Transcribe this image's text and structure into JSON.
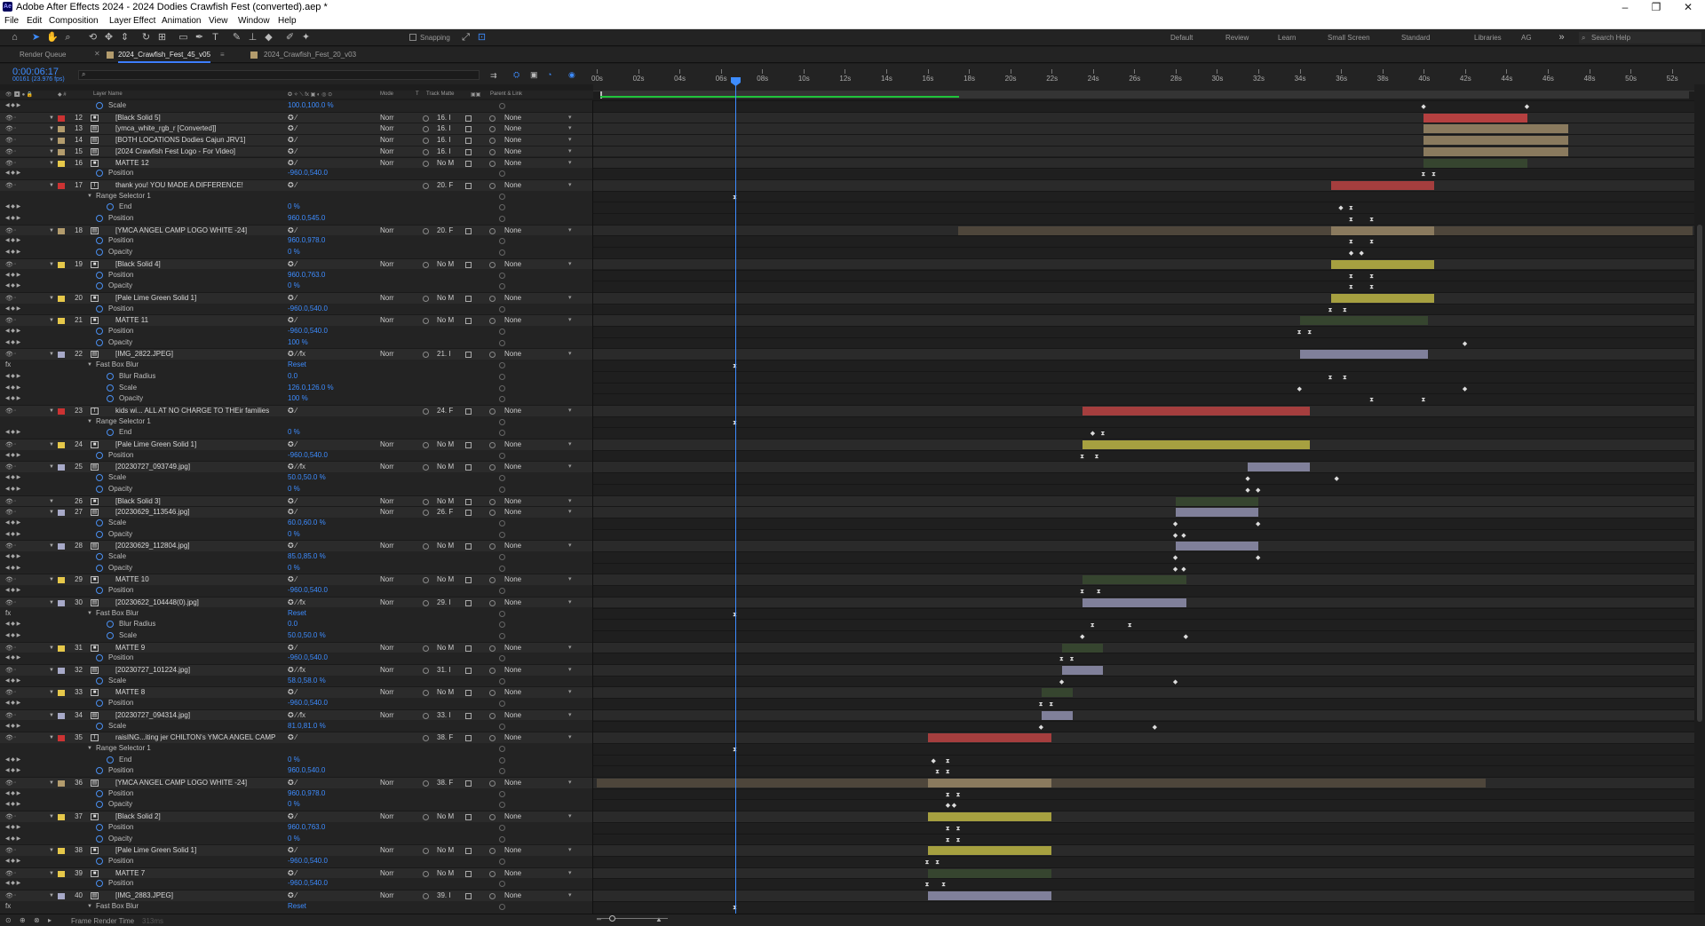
{
  "window": {
    "title": "Adobe After Effects 2024 - 2024 Dodies Crawfish Fest (converted).aep *",
    "app_logo": "Ae"
  },
  "menu": [
    "File",
    "Edit",
    "Composition",
    "Layer",
    "Effect",
    "Animation",
    "View",
    "Window",
    "Help"
  ],
  "toolbar": {
    "snapping_label": "Snapping"
  },
  "workspaces": [
    "Default",
    "Review",
    "Learn",
    "Small Screen",
    "Standard",
    "Libraries",
    "AG"
  ],
  "search_help": "Search Help",
  "tabs": [
    {
      "label": "Render Queue"
    },
    {
      "label": "2024_Crawfish_Fest_45_v05"
    },
    {
      "label": "2024_Crawfish_Fest_20_v03"
    }
  ],
  "timecode": "0:00:06:17",
  "frames": "00161 (23.976 fps)",
  "columns": {
    "layer_name": "Layer Name",
    "mode": "Mode",
    "t": "T",
    "track_matte": "Track Matte",
    "parent": "Parent & Link"
  },
  "ruler": {
    "ticks": [
      "00s",
      "02s",
      "04s",
      "06s",
      "08s",
      "10s",
      "12s",
      "14s",
      "16s",
      "18s",
      "20s",
      "22s",
      "24s",
      "26s",
      "28s",
      "30s",
      "32s",
      "34s",
      "36s",
      "38s",
      "40s",
      "42s",
      "44s",
      "46s",
      "48s",
      "50s",
      "52s"
    ],
    "duration_s": 53
  },
  "playhead_s": 6.7,
  "rows": [
    {
      "t": "p",
      "name": "Scale",
      "val": "100.0,100.0 %",
      "kf": [
        [
          40.0,
          "d"
        ],
        [
          45.0,
          "d"
        ]
      ]
    },
    {
      "t": "l",
      "num": "12",
      "name": "[Black Solid 5]",
      "color": "#cc3333",
      "type": "s",
      "mode": "Norr",
      "tm": "16. I",
      "parent": "None",
      "bar": [
        40.0,
        45.0,
        "#b54040"
      ]
    },
    {
      "t": "l",
      "num": "13",
      "name": "[ymca_white_rgb_r [Converted]]",
      "color": "#b39c6d",
      "type": "i",
      "mode": "Norr",
      "tm": "16. I",
      "parent": "None",
      "bar": [
        40.0,
        47.0,
        "#8a7a5e"
      ]
    },
    {
      "t": "l",
      "num": "14",
      "name": "[BOTH LOCATIONS Dodies Cajun JRV1]",
      "color": "#b39c6d",
      "type": "i",
      "mode": "Norr",
      "tm": "16. I",
      "parent": "None",
      "bar": [
        40.0,
        47.0,
        "#8a7a5e"
      ]
    },
    {
      "t": "l",
      "num": "15",
      "name": "[2024 Crawfish Fest Logo - For Video]",
      "color": "#b39c6d",
      "type": "i",
      "mode": "Norr",
      "tm": "16. I",
      "parent": "None",
      "bar": [
        40.0,
        47.0,
        "#8a7a5e"
      ]
    },
    {
      "t": "l",
      "num": "16",
      "name": "MATTE 12",
      "color": "#e6c84a",
      "type": "s",
      "mode": "Norr",
      "tm": "No M",
      "parent": "None",
      "bar": [
        40.0,
        45.0,
        "#36452f"
      ]
    },
    {
      "t": "p",
      "name": "Position",
      "val": "-960.0,540.0",
      "kf": [
        [
          40.0,
          "i"
        ],
        [
          40.5,
          "i"
        ]
      ]
    },
    {
      "t": "l",
      "num": "17",
      "name": "thank you! YOU MADE A DIFFERENCE!",
      "color": "#cc3333",
      "type": "t",
      "mode": "",
      "tm": "20. F",
      "parent": "None",
      "bar": [
        35.5,
        40.5,
        "#a53e3e"
      ]
    },
    {
      "t": "g",
      "name": "Range Selector 1",
      "kf": [
        [
          6.7,
          "i"
        ]
      ]
    },
    {
      "t": "p",
      "name": "End",
      "val": "0 %",
      "kf": [
        [
          36.0,
          "d"
        ],
        [
          36.5,
          "i"
        ]
      ],
      "indent": 1
    },
    {
      "t": "p",
      "name": "Position",
      "val": "960.0,545.0",
      "kf": [
        [
          36.5,
          "i"
        ],
        [
          37.5,
          "i"
        ]
      ]
    },
    {
      "t": "l",
      "num": "18",
      "name": "[YMCA ANGEL CAMP LOGO WHITE -24]",
      "color": "#b39c6d",
      "type": "i",
      "mode": "Norr",
      "tm": "20. F",
      "parent": "None",
      "bar": [
        35.5,
        40.5,
        "#8a7a5e"
      ],
      "bar2": [
        17.5,
        53,
        "#4e463b"
      ]
    },
    {
      "t": "p",
      "name": "Position",
      "val": "960.0,978.0",
      "kf": [
        [
          36.5,
          "i"
        ],
        [
          37.5,
          "i"
        ]
      ]
    },
    {
      "t": "p",
      "name": "Opacity",
      "val": "0 %",
      "kf": [
        [
          36.5,
          "d"
        ],
        [
          37.0,
          "d"
        ]
      ]
    },
    {
      "t": "l",
      "num": "19",
      "name": "[Black Solid 4]",
      "color": "#e6c84a",
      "type": "s",
      "mode": "Norr",
      "tm": "No M",
      "parent": "None",
      "bar": [
        35.5,
        40.5,
        "#a6a040"
      ]
    },
    {
      "t": "p",
      "name": "Position",
      "val": "960.0,763.0",
      "kf": [
        [
          36.5,
          "i"
        ],
        [
          37.5,
          "i"
        ]
      ]
    },
    {
      "t": "p",
      "name": "Opacity",
      "val": "0 %",
      "kf": [
        [
          36.5,
          "i"
        ],
        [
          37.5,
          "i"
        ]
      ]
    },
    {
      "t": "l",
      "num": "20",
      "name": "[Pale Lime Green Solid 1]",
      "color": "#e6c84a",
      "type": "s",
      "mode": "Norr",
      "tm": "No M",
      "parent": "None",
      "bar": [
        35.5,
        40.5,
        "#a6a040"
      ]
    },
    {
      "t": "p",
      "name": "Position",
      "val": "-960.0,540.0",
      "kf": [
        [
          35.5,
          "i"
        ],
        [
          36.2,
          "i"
        ]
      ]
    },
    {
      "t": "l",
      "num": "21",
      "name": "MATTE 11",
      "color": "#e6c84a",
      "type": "s",
      "mode": "Norr",
      "tm": "No M",
      "parent": "None",
      "bar": [
        34.0,
        40.2,
        "#36452f"
      ]
    },
    {
      "t": "p",
      "name": "Position",
      "val": "-960.0,540.0",
      "kf": [
        [
          34.0,
          "i"
        ],
        [
          34.5,
          "i"
        ]
      ]
    },
    {
      "t": "p",
      "name": "Opacity",
      "val": "100 %",
      "kf": [
        [
          42.0,
          "d"
        ]
      ]
    },
    {
      "t": "l",
      "num": "22",
      "name": "[IMG_2822.JPEG]",
      "color": "#a7a9c8",
      "type": "i",
      "mode": "Norr",
      "tm": "21. I",
      "parent": "None",
      "bar": [
        34.0,
        40.2,
        "#80809a"
      ],
      "fx": true
    },
    {
      "t": "fx",
      "name": "Fast Box Blur",
      "val": "Reset",
      "kf": [
        [
          6.7,
          "i"
        ]
      ]
    },
    {
      "t": "p",
      "name": "Blur Radius",
      "val": "0.0",
      "kf": [
        [
          35.5,
          "i"
        ],
        [
          36.2,
          "i"
        ]
      ],
      "indent": 1
    },
    {
      "t": "p",
      "name": "Scale",
      "val": "126.0,126.0 %",
      "kf": [
        [
          34.0,
          "d"
        ],
        [
          42.0,
          "d"
        ]
      ],
      "indent": 1
    },
    {
      "t": "p",
      "name": "Opacity",
      "val": "100 %",
      "kf": [
        [
          37.5,
          "i"
        ],
        [
          40.0,
          "i"
        ]
      ],
      "indent": 1
    },
    {
      "t": "l",
      "num": "23",
      "name": "kids wi... ALL AT NO CHARGE TO THEir families",
      "color": "#cc3333",
      "type": "t",
      "mode": "",
      "tm": "24. F",
      "parent": "None",
      "bar": [
        23.5,
        34.5,
        "#a53e3e"
      ]
    },
    {
      "t": "g",
      "name": "Range Selector 1",
      "kf": [
        [
          6.7,
          "i"
        ]
      ]
    },
    {
      "t": "p",
      "name": "End",
      "val": "0 %",
      "kf": [
        [
          24.0,
          "d"
        ],
        [
          24.5,
          "i"
        ]
      ],
      "indent": 1
    },
    {
      "t": "l",
      "num": "24",
      "name": "[Pale Lime Green Solid 1]",
      "color": "#e6c84a",
      "type": "s",
      "mode": "Norr",
      "tm": "No M",
      "parent": "None",
      "bar": [
        23.5,
        34.5,
        "#a6a040"
      ]
    },
    {
      "t": "p",
      "name": "Position",
      "val": "-960.0,540.0",
      "kf": [
        [
          23.5,
          "i"
        ],
        [
          24.2,
          "i"
        ]
      ]
    },
    {
      "t": "l",
      "num": "25",
      "name": "[20230727_093749.jpg]",
      "color": "#a7a9c8",
      "type": "i",
      "mode": "Norr",
      "tm": "No M",
      "parent": "None",
      "bar": [
        31.5,
        34.5,
        "#80809a"
      ],
      "fx": true
    },
    {
      "t": "p",
      "name": "Scale",
      "val": "50.0,50.0 %",
      "kf": [
        [
          31.5,
          "d"
        ],
        [
          35.8,
          "d"
        ]
      ]
    },
    {
      "t": "p",
      "name": "Opacity",
      "val": "0 %",
      "kf": [
        [
          31.5,
          "d"
        ],
        [
          32.0,
          "d"
        ]
      ]
    },
    {
      "t": "l",
      "num": "26",
      "name": "[Black Solid 3]",
      "color": "",
      "type": "s",
      "mode": "Norr",
      "tm": "No M",
      "parent": "None",
      "bar": [
        28.0,
        32.0,
        "#36452f"
      ]
    },
    {
      "t": "l",
      "num": "27",
      "name": "[20230629_113546.jpg]",
      "color": "#a7a9c8",
      "type": "i",
      "mode": "Norr",
      "tm": "26. F",
      "parent": "None",
      "bar": [
        28.0,
        32.0,
        "#80809a"
      ]
    },
    {
      "t": "p",
      "name": "Scale",
      "val": "60.0,60.0 %",
      "kf": [
        [
          28.0,
          "d"
        ],
        [
          32.0,
          "d"
        ]
      ]
    },
    {
      "t": "p",
      "name": "Opacity",
      "val": "0 %",
      "kf": [
        [
          28.0,
          "d"
        ],
        [
          28.4,
          "d"
        ]
      ]
    },
    {
      "t": "l",
      "num": "28",
      "name": "[20230629_112804.jpg]",
      "color": "#a7a9c8",
      "type": "i",
      "mode": "Norr",
      "tm": "No M",
      "parent": "None",
      "bar": [
        28.0,
        32.0,
        "#80809a"
      ]
    },
    {
      "t": "p",
      "name": "Scale",
      "val": "85.0,85.0 %",
      "kf": [
        [
          28.0,
          "d"
        ],
        [
          32.0,
          "d"
        ]
      ]
    },
    {
      "t": "p",
      "name": "Opacity",
      "val": "0 %",
      "kf": [
        [
          28.0,
          "d"
        ],
        [
          28.4,
          "d"
        ]
      ]
    },
    {
      "t": "l",
      "num": "29",
      "name": "MATTE 10",
      "color": "#e6c84a",
      "type": "s",
      "mode": "Norr",
      "tm": "No M",
      "parent": "None",
      "bar": [
        23.5,
        28.5,
        "#36452f"
      ]
    },
    {
      "t": "p",
      "name": "Position",
      "val": "-960.0,540.0",
      "kf": [
        [
          23.5,
          "i"
        ],
        [
          24.3,
          "i"
        ]
      ]
    },
    {
      "t": "l",
      "num": "30",
      "name": "[20230622_104448(0).jpg]",
      "color": "#a7a9c8",
      "type": "i",
      "mode": "Norr",
      "tm": "29. I",
      "parent": "None",
      "bar": [
        23.5,
        28.5,
        "#80809a"
      ],
      "fx": true
    },
    {
      "t": "fx",
      "name": "Fast Box Blur",
      "val": "Reset",
      "kf": [
        [
          6.7,
          "i"
        ]
      ]
    },
    {
      "t": "p",
      "name": "Blur Radius",
      "val": "0.0",
      "kf": [
        [
          24.0,
          "i"
        ],
        [
          25.8,
          "i"
        ]
      ],
      "indent": 1
    },
    {
      "t": "p",
      "name": "Scale",
      "val": "50.0,50.0 %",
      "kf": [
        [
          23.5,
          "d"
        ],
        [
          28.5,
          "d"
        ]
      ],
      "indent": 1
    },
    {
      "t": "l",
      "num": "31",
      "name": "MATTE 9",
      "color": "#e6c84a",
      "type": "s",
      "mode": "Norr",
      "tm": "No M",
      "parent": "None",
      "bar": [
        22.5,
        24.5,
        "#36452f"
      ]
    },
    {
      "t": "p",
      "name": "Position",
      "val": "-960.0,540.0",
      "kf": [
        [
          22.5,
          "i"
        ],
        [
          23.0,
          "i"
        ]
      ]
    },
    {
      "t": "l",
      "num": "32",
      "name": "[20230727_101224.jpg]",
      "color": "#a7a9c8",
      "type": "i",
      "mode": "Norr",
      "tm": "31. I",
      "parent": "None",
      "bar": [
        22.5,
        24.5,
        "#80809a"
      ],
      "fx": true
    },
    {
      "t": "p",
      "name": "Scale",
      "val": "58.0,58.0 %",
      "kf": [
        [
          22.5,
          "d"
        ],
        [
          28.0,
          "d"
        ]
      ]
    },
    {
      "t": "l",
      "num": "33",
      "name": "MATTE 8",
      "color": "#e6c84a",
      "type": "s",
      "mode": "Norr",
      "tm": "No M",
      "parent": "None",
      "bar": [
        21.5,
        23.0,
        "#36452f"
      ]
    },
    {
      "t": "p",
      "name": "Position",
      "val": "-960.0,540.0",
      "kf": [
        [
          21.5,
          "i"
        ],
        [
          22.0,
          "i"
        ]
      ]
    },
    {
      "t": "l",
      "num": "34",
      "name": "[20230727_094314.jpg]",
      "color": "#a7a9c8",
      "type": "i",
      "mode": "Norr",
      "tm": "33. I",
      "parent": "None",
      "bar": [
        21.5,
        23.0,
        "#80809a"
      ],
      "fx": true
    },
    {
      "t": "p",
      "name": "Scale",
      "val": "81.0,81.0 %",
      "kf": [
        [
          21.5,
          "d"
        ],
        [
          27.0,
          "d"
        ]
      ]
    },
    {
      "t": "l",
      "num": "35",
      "name": "raisING...iting jer CHILTON's YMCA ANGEL CAMP",
      "color": "#cc3333",
      "type": "t",
      "mode": "",
      "tm": "38. F",
      "parent": "None",
      "bar": [
        16.0,
        22.0,
        "#a53e3e"
      ]
    },
    {
      "t": "g",
      "name": "Range Selector 1",
      "kf": [
        [
          6.7,
          "i"
        ]
      ]
    },
    {
      "t": "p",
      "name": "End",
      "val": "0 %",
      "kf": [
        [
          16.3,
          "d"
        ],
        [
          17.0,
          "i"
        ]
      ],
      "indent": 1
    },
    {
      "t": "p",
      "name": "Position",
      "val": "960.0,540.0",
      "kf": [
        [
          16.5,
          "i"
        ],
        [
          17.0,
          "i"
        ]
      ]
    },
    {
      "t": "l",
      "num": "36",
      "name": "[YMCA ANGEL CAMP LOGO WHITE -24]",
      "color": "#b39c6d",
      "type": "i",
      "mode": "Norr",
      "tm": "38. F",
      "parent": "None",
      "bar": [
        16.0,
        22.0,
        "#8a7a5e"
      ],
      "bar2": [
        0,
        43,
        "#4e463b"
      ]
    },
    {
      "t": "p",
      "name": "Position",
      "val": "960.0,978.0",
      "kf": [
        [
          17.0,
          "i"
        ],
        [
          17.5,
          "i"
        ]
      ]
    },
    {
      "t": "p",
      "name": "Opacity",
      "val": "0 %",
      "kf": [
        [
          17.0,
          "d"
        ],
        [
          17.3,
          "d"
        ]
      ]
    },
    {
      "t": "l",
      "num": "37",
      "name": "[Black Solid 2]",
      "color": "#e6c84a",
      "type": "s",
      "mode": "Norr",
      "tm": "No M",
      "parent": "None",
      "bar": [
        16.0,
        22.0,
        "#a6a040"
      ]
    },
    {
      "t": "p",
      "name": "Position",
      "val": "960.0,763.0",
      "kf": [
        [
          17.0,
          "i"
        ],
        [
          17.5,
          "i"
        ]
      ]
    },
    {
      "t": "p",
      "name": "Opacity",
      "val": "0 %",
      "kf": [
        [
          17.0,
          "i"
        ],
        [
          17.5,
          "i"
        ]
      ]
    },
    {
      "t": "l",
      "num": "38",
      "name": "[Pale Lime Green Solid 1]",
      "color": "#e6c84a",
      "type": "s",
      "mode": "Norr",
      "tm": "No M",
      "parent": "None",
      "bar": [
        16.0,
        22.0,
        "#a6a040"
      ]
    },
    {
      "t": "p",
      "name": "Position",
      "val": "-960.0,540.0",
      "kf": [
        [
          16.0,
          "i"
        ],
        [
          16.5,
          "i"
        ]
      ]
    },
    {
      "t": "l",
      "num": "39",
      "name": "MATTE 7",
      "color": "#e6c84a",
      "type": "s",
      "mode": "Norr",
      "tm": "No M",
      "parent": "None",
      "bar": [
        16.0,
        22.0,
        "#36452f"
      ]
    },
    {
      "t": "p",
      "name": "Position",
      "val": "-960.0,540.0",
      "kf": [
        [
          16.0,
          "i"
        ],
        [
          16.8,
          "i"
        ]
      ]
    },
    {
      "t": "l",
      "num": "40",
      "name": "[IMG_2883.JPEG]",
      "color": "#a7a9c8",
      "type": "i",
      "mode": "Norr",
      "tm": "39. I",
      "parent": "None",
      "bar": [
        16.0,
        22.0,
        "#80809a"
      ]
    },
    {
      "t": "fx",
      "name": "Fast Box Blur",
      "val": "Reset",
      "kf": [
        [
          6.7,
          "i"
        ]
      ]
    }
  ],
  "bottom": {
    "label": "Frame Render Time",
    "value": "313ms"
  }
}
